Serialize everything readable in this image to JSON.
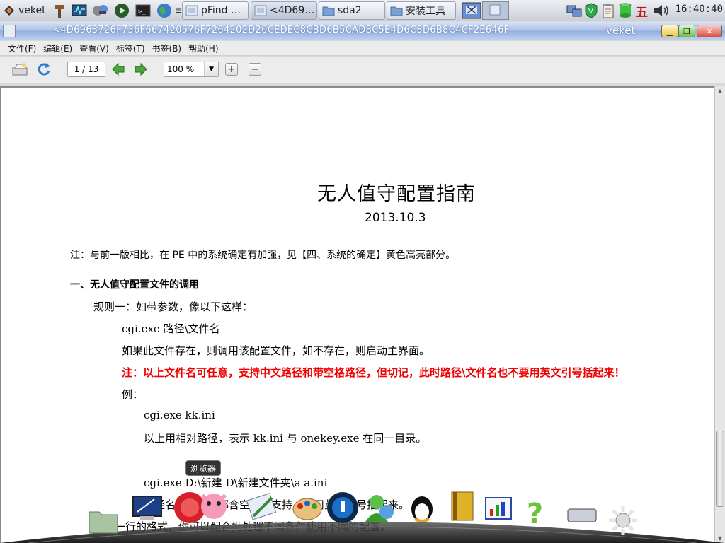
{
  "taskbar": {
    "menu_label": "veket",
    "buttons": [
      {
        "label": "pFind …"
      },
      {
        "label": "<4D69…"
      },
      {
        "label": "sda2"
      },
      {
        "label": "安装工具"
      }
    ],
    "ime": "五",
    "clock": "16:40:40"
  },
  "window": {
    "title": "<4D6963726F736F667420576F7264202D20CEDEC8CBD6B5CAD8C5E4D6C3D6B8C4CF2E646F",
    "wm_name": "veket"
  },
  "menubar": {
    "items": [
      "文件(F)",
      "编辑(E)",
      "查看(V)",
      "标签(T)",
      "书签(B)",
      "帮助(H)"
    ]
  },
  "toolbar": {
    "page_indicator": "1 / 13",
    "zoom": "100 %"
  },
  "document": {
    "title": "无人值守配置指南",
    "date": "2013.10.3",
    "note": "注：与前一版相比，在 PE 中的系统确定有加强，见【四、系统的确定】黄色高亮部分。",
    "section1_heading": "一、无人值守配置文件的调用",
    "rule1": "规则一：如带参数，像以下这样：",
    "cmd1": "cgi.exe  路径\\文件名",
    "desc1": "如果此文件存在，则调用该配置文件，如不存在，则启动主界面。",
    "warning": "注：以上文件名可任意，支持中文路径和带空格路径，但切记，此时路径\\文件名也不要用英文引号括起来！",
    "example_label": "例：",
    "cmd2": "cgi.exe kk.ini",
    "desc2": "以上用相对路径，表示 kk.ini 与 onekey.exe 在同一目录。",
    "cmd3": "cgi.exe D:\\新建 D\\新建文件夹\\a a.ini",
    "desc3": "路径名和文件名都含空格，支持，不用英文引号括起来。",
    "tail": "用第一行的格式，你可以配合批处理不同条件使用不同的配置。"
  },
  "dock": {
    "tooltip": "浏览器"
  },
  "colors": {
    "warning_red": "#f00000",
    "titlebar_blue": "#93ade0"
  }
}
